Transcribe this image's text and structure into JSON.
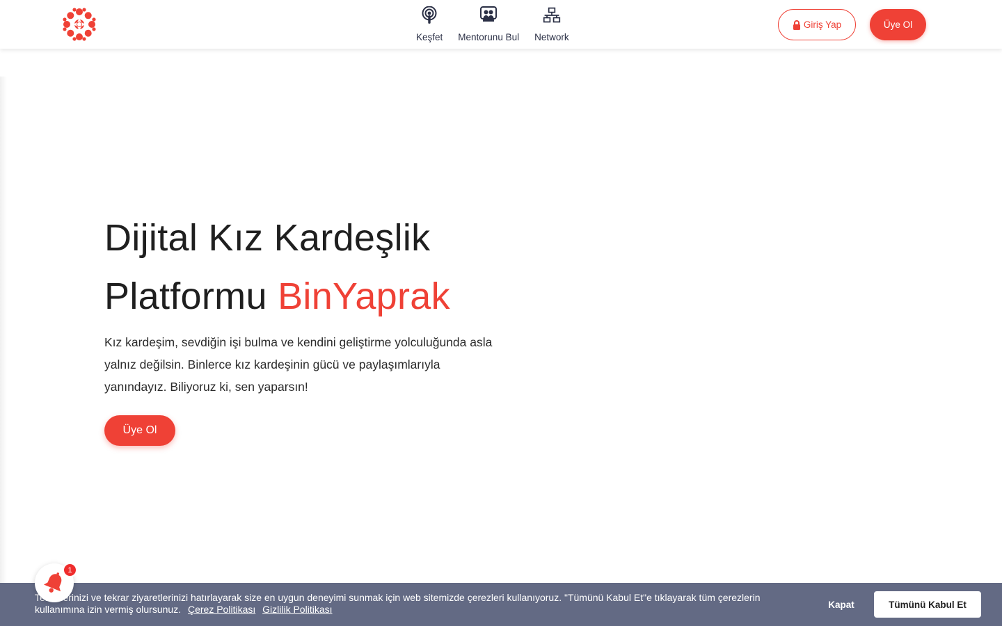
{
  "header": {
    "logo_alt": "BinYaprak logo",
    "nav": [
      {
        "label": "Keşfet",
        "icon": "podcast-icon"
      },
      {
        "label": "Mentorunu Bul",
        "icon": "mentor-icon"
      },
      {
        "label": "Network",
        "icon": "network-icon"
      }
    ],
    "login_label": "Giriş Yap",
    "signup_label": "Üye Ol"
  },
  "hero": {
    "title_line1": "Dijital Kız Kardeşlik",
    "title_line2_prefix": "Platformu ",
    "title_brand": "BinYaprak",
    "description": "Kız kardeşim, sevdiğin işi bulma ve kendini geliştirme yolculuğunda asla yalnız değilsin.  Binlerce kız kardeşinin gücü ve paylaşımlarıyla yanındayız. Biliyoruz ki, sen yaparsın!",
    "cta_label": "Üye Ol"
  },
  "cookie": {
    "text": "Tercihlerinizi ve tekrar ziyaretlerinizi hatırlayarak size en uygun deneyimi sunmak için web sitemizde çerezleri kullanıyoruz. \"Tümünü Kabul Et\"e tıklayarak tüm çerezlerin kullanımına izin vermiş olursunuz.",
    "cookie_policy_link": "Çerez Politikası",
    "privacy_policy_link": "Gizlilik Politikası",
    "close_label": "Kapat",
    "accept_label": "Tümünü Kabul Et"
  },
  "notification": {
    "badge_count": "1"
  },
  "colors": {
    "accent": "#ef4136",
    "nav_text": "#2a2f45",
    "cookie_bar": "#636a84"
  }
}
